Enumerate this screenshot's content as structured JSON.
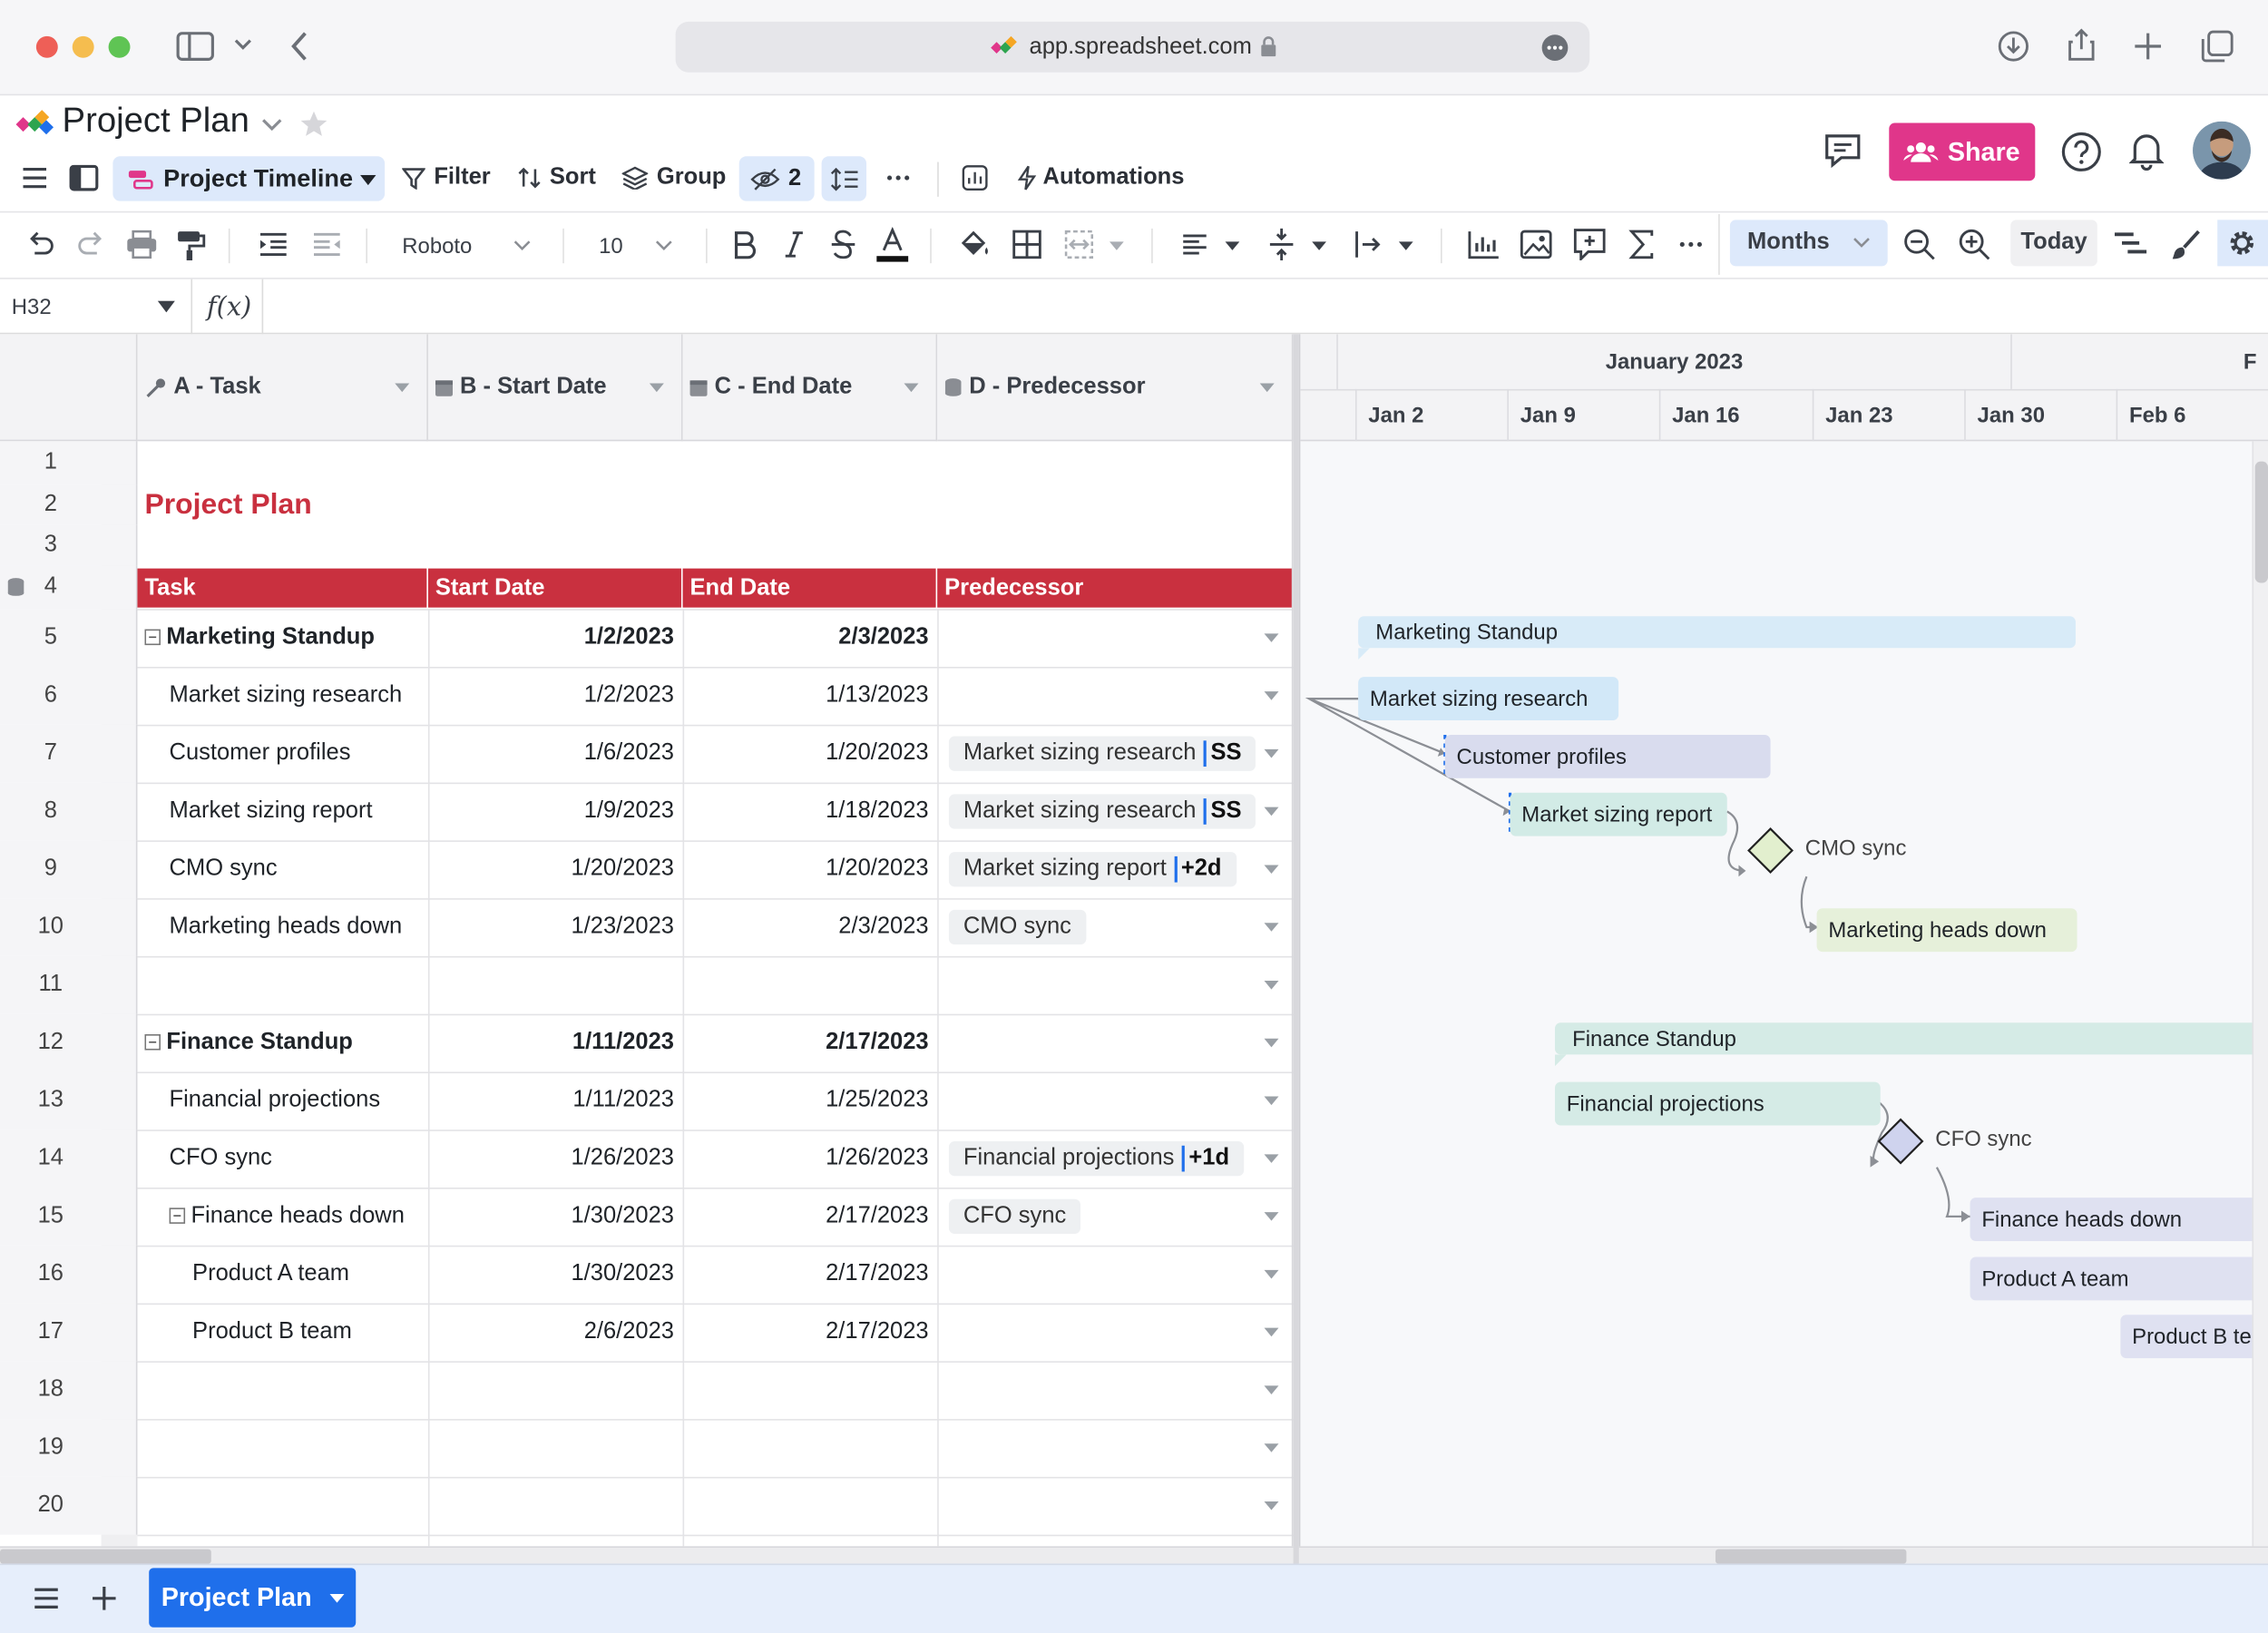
{
  "browser": {
    "address": "app.spreadsheet.com"
  },
  "header": {
    "title": "Project Plan",
    "share_label": "Share"
  },
  "toolbar": {
    "view_label": "Project Timeline",
    "filter_label": "Filter",
    "sort_label": "Sort",
    "group_label": "Group",
    "hidden_count": "2",
    "automations_label": "Automations"
  },
  "format": {
    "font": "Roboto",
    "size": "10",
    "zoom_unit": "Months",
    "today_label": "Today"
  },
  "formula": {
    "cell_ref": "H32",
    "fx": "f(x)"
  },
  "columns": [
    {
      "label": "A - Task"
    },
    {
      "label": "B - Start Date"
    },
    {
      "label": "C - End Date"
    },
    {
      "label": "D - Predecessor"
    }
  ],
  "rows": [
    {
      "n": "1"
    },
    {
      "n": "2"
    },
    {
      "n": "3"
    },
    {
      "n": "4"
    },
    {
      "n": "5"
    },
    {
      "n": "6"
    },
    {
      "n": "7"
    },
    {
      "n": "8"
    },
    {
      "n": "9"
    },
    {
      "n": "10"
    },
    {
      "n": "11"
    },
    {
      "n": "12"
    },
    {
      "n": "13"
    },
    {
      "n": "14"
    },
    {
      "n": "15"
    },
    {
      "n": "16"
    },
    {
      "n": "17"
    },
    {
      "n": "18"
    },
    {
      "n": "19"
    },
    {
      "n": "20"
    }
  ],
  "sheet": {
    "heading": "Project Plan",
    "table_headers": [
      "Task",
      "Start Date",
      "End Date",
      "Predecessor"
    ],
    "tasks": [
      {
        "task": "Marketing Standup",
        "start": "1/2/2023",
        "end": "2/3/2023",
        "bold": true,
        "group": true
      },
      {
        "task": "Market sizing research",
        "start": "1/2/2023",
        "end": "1/13/2023"
      },
      {
        "task": "Customer profiles",
        "start": "1/6/2023",
        "end": "1/20/2023",
        "pred": "Market sizing research",
        "lag": "SS"
      },
      {
        "task": "Market sizing report",
        "start": "1/9/2023",
        "end": "1/18/2023",
        "pred": "Market sizing research",
        "lag": "SS"
      },
      {
        "task": "CMO sync",
        "start": "1/20/2023",
        "end": "1/20/2023",
        "pred": "Market sizing report",
        "lag": "+2d"
      },
      {
        "task": "Marketing heads down",
        "start": "1/23/2023",
        "end": "2/3/2023",
        "pred": "CMO sync"
      },
      {
        "task": ""
      },
      {
        "task": "Finance Standup",
        "start": "1/11/2023",
        "end": "2/17/2023",
        "bold": true,
        "group": true
      },
      {
        "task": "Financial projections",
        "start": "1/11/2023",
        "end": "1/25/2023"
      },
      {
        "task": "CFO sync",
        "start": "1/26/2023",
        "end": "1/26/2023",
        "pred": "Financial projections",
        "lag": "+1d"
      },
      {
        "task": "Finance heads down",
        "start": "1/30/2023",
        "end": "2/17/2023",
        "pred": "CFO sync",
        "group": true
      },
      {
        "task": "Product A team",
        "start": "1/30/2023",
        "end": "2/17/2023",
        "indent": true
      },
      {
        "task": "Product B team",
        "start": "2/6/2023",
        "end": "2/17/2023",
        "indent": true
      },
      {
        "task": ""
      },
      {
        "task": ""
      },
      {
        "task": ""
      }
    ]
  },
  "gantt": {
    "month": "January 2023",
    "month_next": "F",
    "weeks": [
      "Jan 2",
      "Jan 9",
      "Jan 16",
      "Jan 23",
      "Jan 30",
      "Feb 6"
    ],
    "bars": [
      {
        "label": "Marketing Standup",
        "color": "#d8ebf8"
      },
      {
        "label": "Market sizing research",
        "color": "#d2e8f8"
      },
      {
        "label": "Customer profiles",
        "color": "#d9dcee"
      },
      {
        "label": "Market sizing report",
        "color": "#d2ebe6"
      },
      {
        "label": "CMO sync",
        "color": "#e2efce"
      },
      {
        "label": "Marketing heads down",
        "color": "#e6f0da"
      },
      {
        "label": "Finance Standup",
        "color": "#d5ebe6"
      },
      {
        "label": "Financial projections",
        "color": "#d5ebe6"
      },
      {
        "label": "CFO sync",
        "color": "#cfd3ee"
      },
      {
        "label": "Finance heads down",
        "color": "#dfe1f1"
      },
      {
        "label": "Product A team",
        "color": "#dfe1f1"
      },
      {
        "label": "Product B team",
        "color": "#dfe1f1"
      }
    ]
  },
  "bottom": {
    "sheet_tab": "Project Plan"
  },
  "colors": {
    "accent": "#1f6feb",
    "share": "#e0368a",
    "header_red": "#c9303f",
    "title_red": "#c9303f"
  }
}
